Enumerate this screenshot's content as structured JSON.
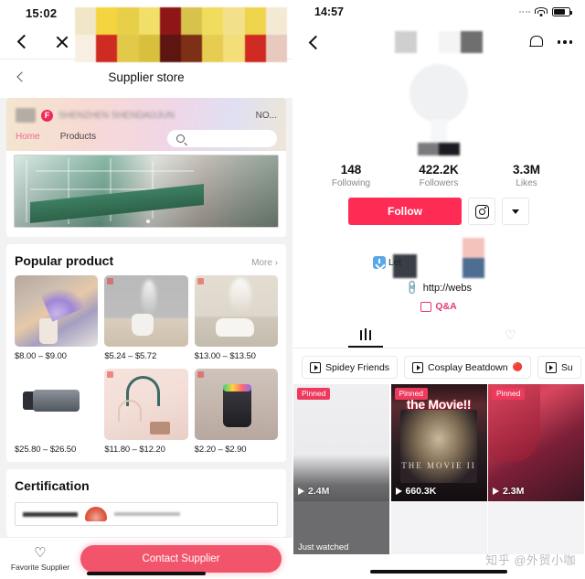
{
  "left": {
    "status_time": "15:02",
    "nav": {
      "back_icon": "back-chevron-icon",
      "close_icon": "close-x-icon"
    },
    "subnav": {
      "back_icon": "back-chevron-icon",
      "title": "Supplier store"
    },
    "store": {
      "badge": "F",
      "name_tail": "NO...",
      "tabs": [
        {
          "label": "Home",
          "active": true
        },
        {
          "label": "Products",
          "active": false
        }
      ],
      "search_placeholder": ""
    },
    "popular": {
      "title": "Popular product",
      "more_label": "More",
      "products": [
        {
          "price": "$8.00 – $9.00"
        },
        {
          "price": "$5.24 – $5.72"
        },
        {
          "price": "$13.00 – $13.50"
        },
        {
          "price": "$25.80 – $26.50"
        },
        {
          "price": "$11.80 – $12.20"
        },
        {
          "price": "$2.20 – $2.90"
        }
      ]
    },
    "certification": {
      "title": "Certification"
    },
    "bottom_bar": {
      "favorite_label": "Favorite Supplier",
      "contact_label": "Contact Supplier",
      "heart_icon": "heart-outline-icon",
      "accent_color": "#f2556b"
    }
  },
  "right": {
    "status_time": "14:57",
    "status_icons": [
      "signal-dots-icon",
      "wifi-icon",
      "battery-icon"
    ],
    "nav": {
      "back_icon": "back-chevron-icon",
      "bell_icon": "bell-icon",
      "more_icon": "more-dots-icon"
    },
    "stats": [
      {
        "value": "148",
        "label": "Following"
      },
      {
        "value": "422.2K",
        "label": "Followers"
      },
      {
        "value": "3.3M",
        "label": "Likes"
      }
    ],
    "actions": {
      "follow_label": "Follow",
      "follow_color": "#fe2c55",
      "instagram_icon": "instagram-icon",
      "dropdown_icon": "chevron-down-icon"
    },
    "bio": {
      "download_label": "Let",
      "link_icon": "link-icon",
      "link_text": "http://webs",
      "qa_icon": "qa-icon",
      "qa_label": "Q&A"
    },
    "tabs": [
      {
        "icon": "grid-posts-icon",
        "active": true
      },
      {
        "icon": "liked-heart-icon",
        "active": false
      }
    ],
    "playlists": [
      {
        "label": "Spidey Friends",
        "emoji": "",
        "icon": "playlist-icon"
      },
      {
        "label": "Cosplay Beatdown",
        "emoji": "🔴",
        "icon": "playlist-icon"
      },
      {
        "label": "Su",
        "emoji": "",
        "icon": "playlist-icon"
      }
    ],
    "videos": [
      {
        "pinned_label": "Pinned",
        "views": "2.4M",
        "title": "",
        "subtitle": ""
      },
      {
        "pinned_label": "Pinned",
        "views": "660.3K",
        "title": "the Movie!!",
        "subtitle": "THE MOVIE II"
      },
      {
        "pinned_label": "Pinned",
        "views": "2.3M",
        "title": "",
        "subtitle": ""
      }
    ],
    "videos_row2": [
      {
        "label": "Just watched"
      },
      {
        "label": ""
      },
      {
        "label": ""
      }
    ]
  },
  "watermark": "知乎 @外贸小咖"
}
